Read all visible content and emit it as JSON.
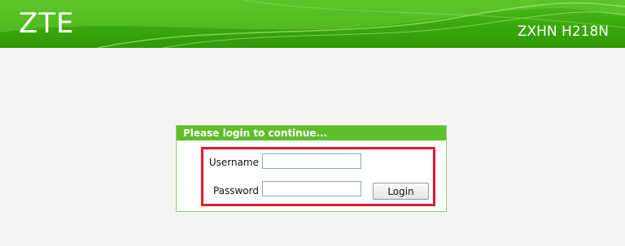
{
  "header": {
    "logo": "ZTE",
    "model": "ZXHN H218N",
    "background_color": "#3aa80c"
  },
  "login": {
    "title": "Please login to continue...",
    "username_label": "Username",
    "username_value": "",
    "password_label": "Password",
    "password_value": "",
    "login_button": "Login",
    "highlight_color": "#e01a2b",
    "title_bar_color": "#5fbf2a"
  }
}
